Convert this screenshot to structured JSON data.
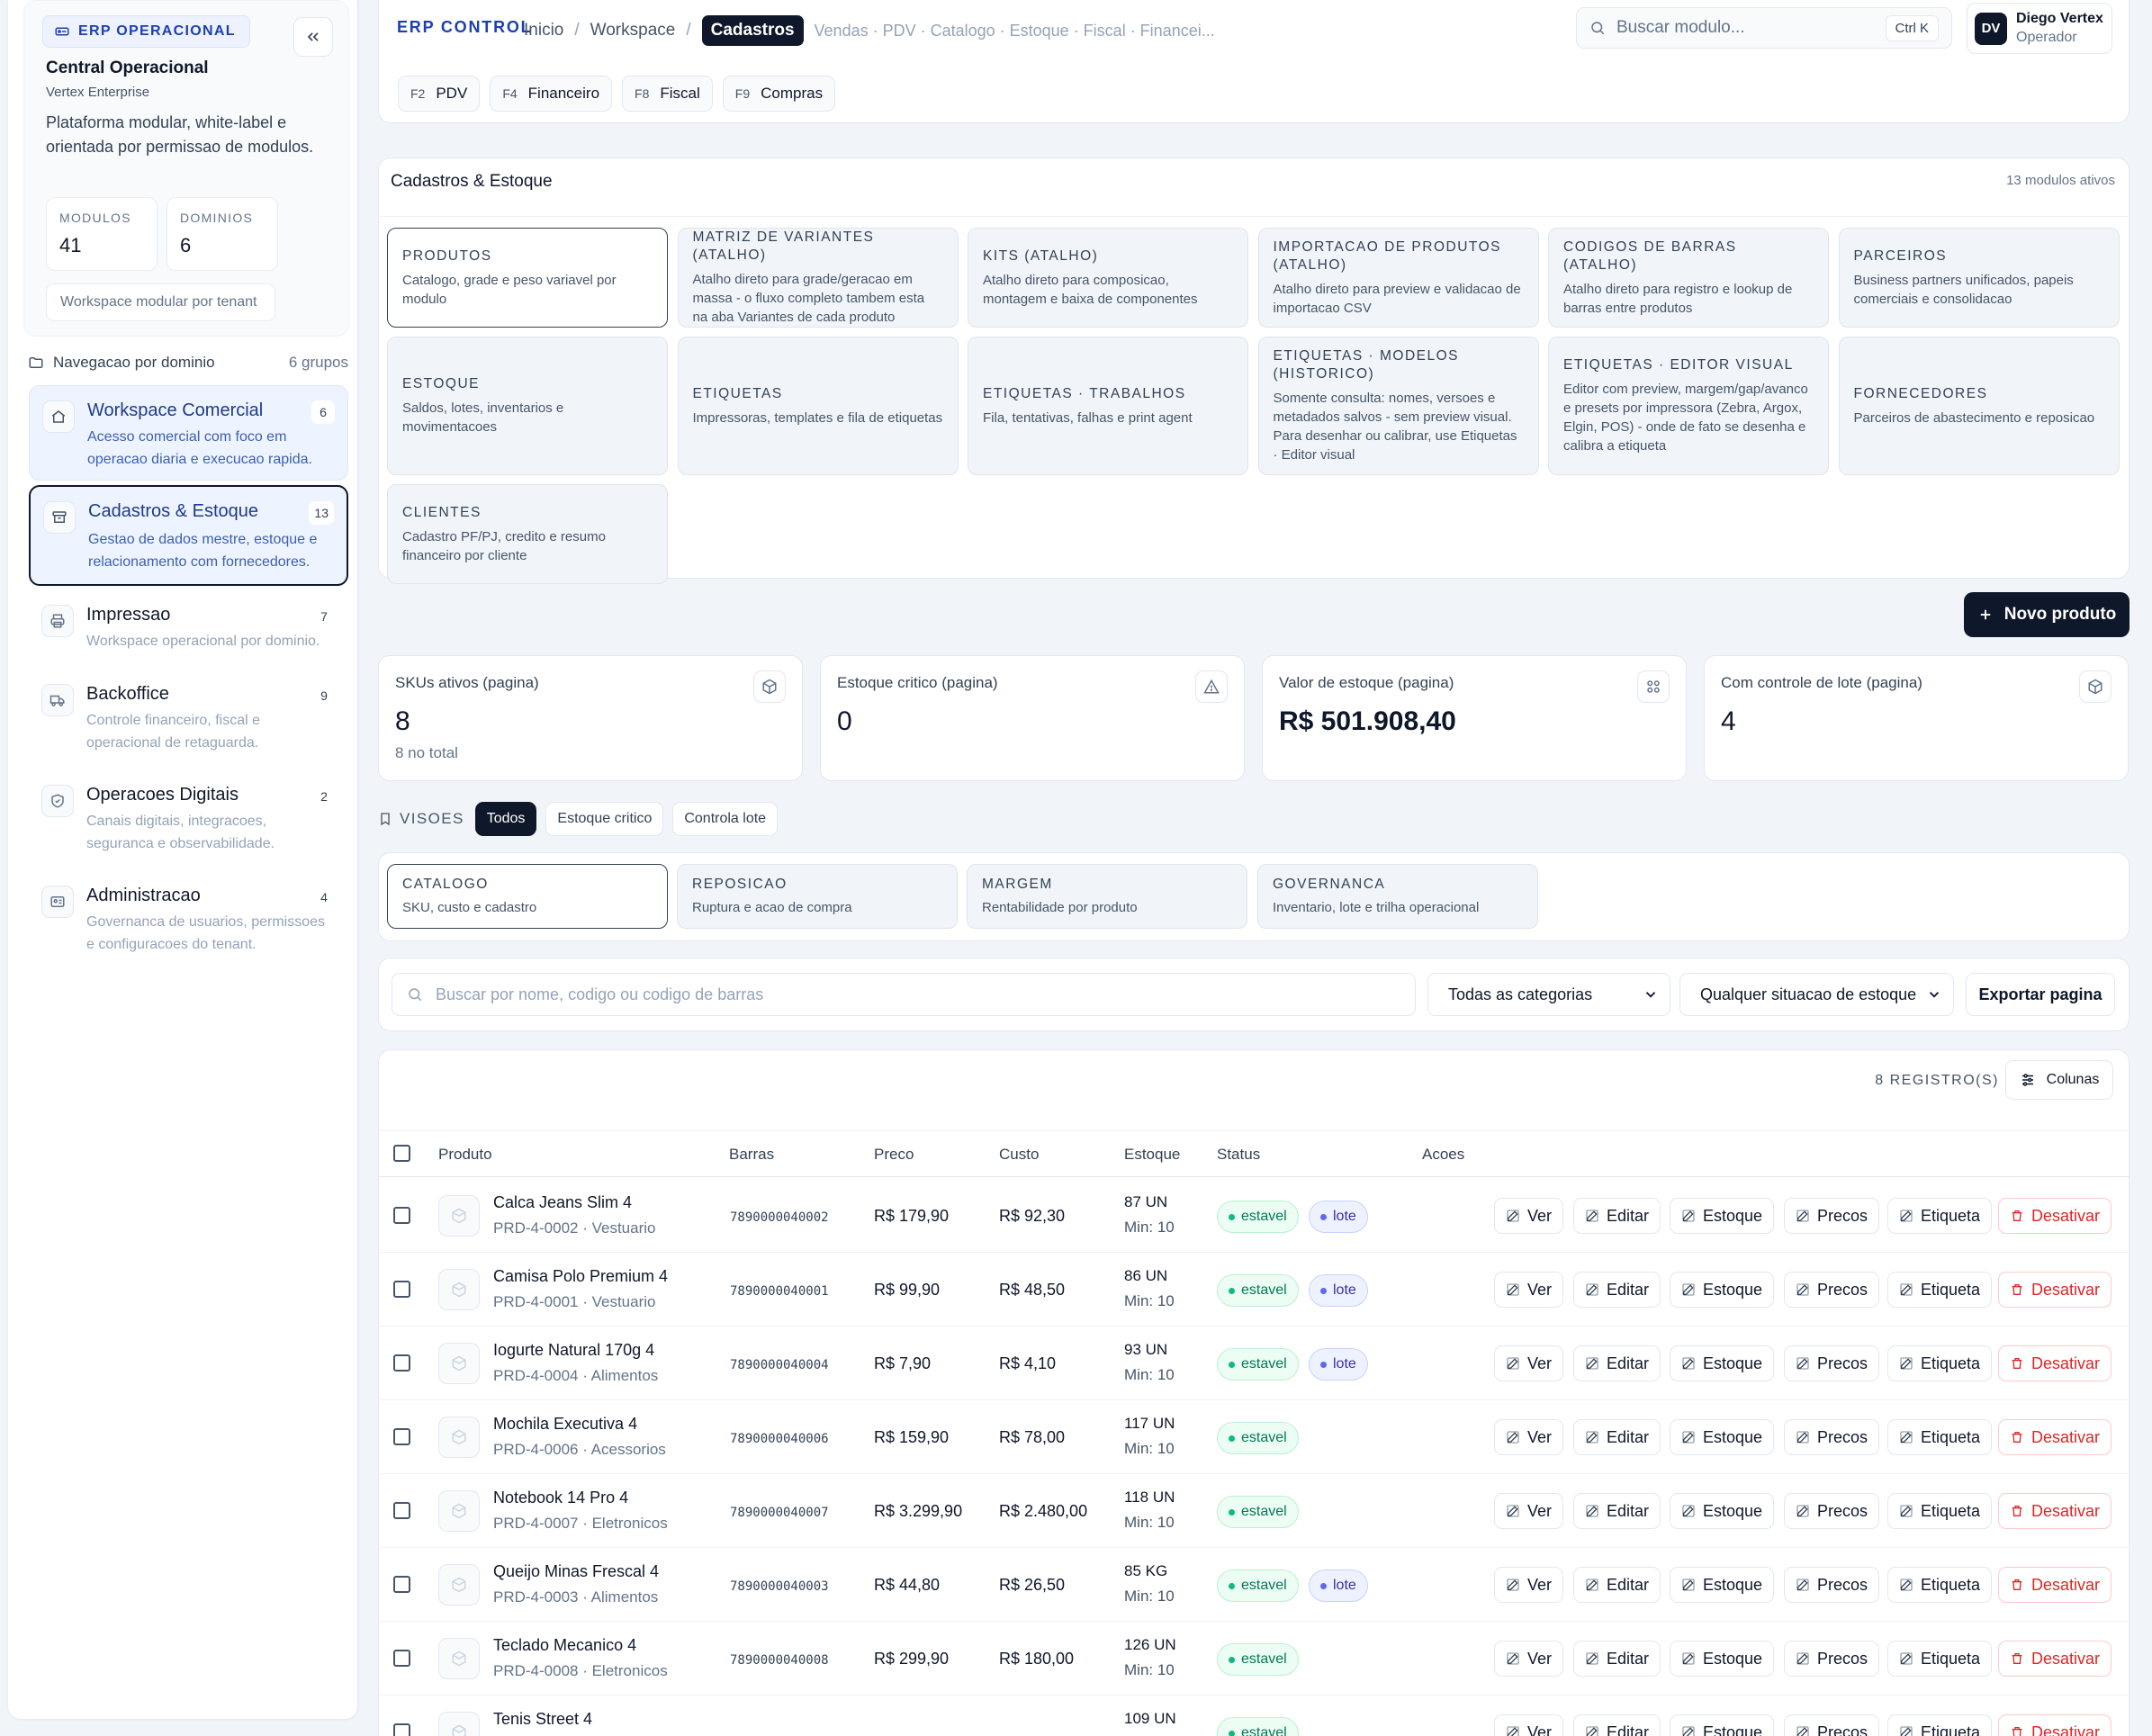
{
  "sidebar": {
    "badge": "ERP OPERACIONAL",
    "org_name": "Central Operacional",
    "org_sub": "Vertex Enterprise",
    "description": "Plataforma modular, white-label e orientada por permissao de modulos.",
    "stats": [
      {
        "label": "MODULOS",
        "value": "41"
      },
      {
        "label": "DOMINIOS",
        "value": "6"
      }
    ],
    "workspace_pill": "Workspace modular por tenant",
    "nav_header": "Navegacao por dominio",
    "nav_count": "6 grupos",
    "items": [
      {
        "title": "Workspace Comercial",
        "count": "6",
        "desc": "Acesso comercial com foco em operacao diaria e execucao rapida.",
        "icon": "home-icon"
      },
      {
        "title": "Cadastros & Estoque",
        "count": "13",
        "desc": "Gestao de dados mestre, estoque e relacionamento com fornecedores.",
        "icon": "archive-icon"
      },
      {
        "title": "Impressao",
        "count": "7",
        "desc": "Workspace operacional por dominio.",
        "icon": "printer-icon"
      },
      {
        "title": "Backoffice",
        "count": "9",
        "desc": "Controle financeiro, fiscal e operacional de retaguarda.",
        "icon": "truck-icon"
      },
      {
        "title": "Operacoes Digitais",
        "count": "2",
        "desc": "Canais digitais, integracoes, seguranca e observabilidade.",
        "icon": "shield-icon"
      },
      {
        "title": "Administracao",
        "count": "4",
        "desc": "Governanca de usuarios, permissoes e configuracoes do tenant.",
        "icon": "id-card-icon"
      }
    ]
  },
  "topbar": {
    "title": "ERP CONTROL",
    "breadcrumbs": [
      "Inicio",
      "Workspace"
    ],
    "current": "Cadastros",
    "more": "Vendas · PDV · Catalogo · Estoque · Fiscal · Financei...",
    "search_placeholder": "Buscar modulo...",
    "search_kbd": "Ctrl K",
    "user_initials": "DV",
    "user_name": "Diego Vertex",
    "user_role": "Operador",
    "shortcuts": [
      {
        "key": "F2",
        "label": "PDV"
      },
      {
        "key": "F4",
        "label": "Financeiro"
      },
      {
        "key": "F8",
        "label": "Fiscal"
      },
      {
        "key": "F9",
        "label": "Compras"
      }
    ]
  },
  "modules": {
    "title": "Cadastros & Estoque",
    "count": "13 modulos ativos",
    "cards": [
      {
        "title": "PRODUTOS",
        "desc": "Catalogo, grade e peso variavel por modulo"
      },
      {
        "title": "MATRIZ DE VARIANTES (ATALHO)",
        "desc": "Atalho direto para grade/geracao em massa - o fluxo completo tambem esta na aba Variantes de cada produto"
      },
      {
        "title": "KITS (ATALHO)",
        "desc": "Atalho direto para composicao, montagem e baixa de componentes"
      },
      {
        "title": "IMPORTACAO DE PRODUTOS (ATALHO)",
        "desc": "Atalho direto para preview e validacao de importacao CSV"
      },
      {
        "title": "CODIGOS DE BARRAS (ATALHO)",
        "desc": "Atalho direto para registro e lookup de barras entre produtos"
      },
      {
        "title": "PARCEIROS",
        "desc": "Business partners unificados, papeis comerciais e consolidacao"
      },
      {
        "title": "ESTOQUE",
        "desc": "Saldos, lotes, inventarios e movimentacoes"
      },
      {
        "title": "ETIQUETAS",
        "desc": "Impressoras, templates e fila de etiquetas"
      },
      {
        "title": "ETIQUETAS · TRABALHOS",
        "desc": "Fila, tentativas, falhas e print agent"
      },
      {
        "title": "ETIQUETAS · MODELOS (HISTORICO)",
        "desc": "Somente consulta: nomes, versoes e metadados salvos - sem preview visual. Para desenhar ou calibrar, use Etiquetas · Editor visual"
      },
      {
        "title": "ETIQUETAS · EDITOR VISUAL",
        "desc": "Editor com preview, margem/gap/avanco e presets por impressora (Zebra, Argox, Elgin, POS) - onde de fato se desenha e calibra a etiqueta"
      },
      {
        "title": "FORNECEDORES",
        "desc": "Parceiros de abastecimento e reposicao"
      },
      {
        "title": "CLIENTES",
        "desc": "Cadastro PF/PJ, credito e resumo financeiro por cliente"
      }
    ]
  },
  "new_product_label": "Novo produto",
  "kpis": [
    {
      "label": "SKUs ativos (pagina)",
      "value": "8",
      "sub": "8 no total",
      "icon": "box-icon"
    },
    {
      "label": "Estoque critico (pagina)",
      "value": "0",
      "sub": "",
      "icon": "alert-triangle-icon"
    },
    {
      "label": "Valor de estoque (pagina)",
      "value": "R$ 501.908,40",
      "sub": "",
      "icon": "grid-icon"
    },
    {
      "label": "Com controle de lote (pagina)",
      "value": "4",
      "sub": "",
      "icon": "box-icon"
    }
  ],
  "views": {
    "label": "VISOES",
    "tabs": [
      "Todos",
      "Estoque critico",
      "Controla lote"
    ],
    "cards": [
      {
        "title": "CATALOGO",
        "desc": "SKU, custo e cadastro"
      },
      {
        "title": "REPOSICAO",
        "desc": "Ruptura e acao de compra"
      },
      {
        "title": "MARGEM",
        "desc": "Rentabilidade por produto"
      },
      {
        "title": "GOVERNANCA",
        "desc": "Inventario, lote e trilha operacional"
      }
    ]
  },
  "filters": {
    "search_placeholder": "Buscar por nome, codigo ou codigo de barras",
    "category": "Todas as categorias",
    "stock_status": "Qualquer situacao de estoque",
    "export": "Exportar pagina"
  },
  "table": {
    "records": "8 REGISTRO(S)",
    "columns_btn": "Colunas",
    "headers": [
      "Produto",
      "Barras",
      "Preco",
      "Custo",
      "Estoque",
      "Status",
      "Acoes"
    ],
    "actions": [
      "Ver",
      "Editar",
      "Estoque",
      "Precos",
      "Etiqueta",
      "Desativar"
    ],
    "rows": [
      {
        "name": "Calca Jeans Slim 4",
        "sub": "PRD-4-0002 · Vestuario",
        "barcode": "7890000040002",
        "price": "R$ 179,90",
        "cost": "R$ 92,30",
        "stock": "87 UN",
        "min": "Min: 10",
        "status": "estavel",
        "lot": "lote"
      },
      {
        "name": "Camisa Polo Premium 4",
        "sub": "PRD-4-0001 · Vestuario",
        "barcode": "7890000040001",
        "price": "R$ 99,90",
        "cost": "R$ 48,50",
        "stock": "86 UN",
        "min": "Min: 10",
        "status": "estavel",
        "lot": "lote"
      },
      {
        "name": "Iogurte Natural 170g 4",
        "sub": "PRD-4-0004 · Alimentos",
        "barcode": "7890000040004",
        "price": "R$ 7,90",
        "cost": "R$ 4,10",
        "stock": "93 UN",
        "min": "Min: 10",
        "status": "estavel",
        "lot": "lote"
      },
      {
        "name": "Mochila Executiva 4",
        "sub": "PRD-4-0006 · Acessorios",
        "barcode": "7890000040006",
        "price": "R$ 159,90",
        "cost": "R$ 78,00",
        "stock": "117 UN",
        "min": "Min: 10",
        "status": "estavel",
        "lot": ""
      },
      {
        "name": "Notebook 14 Pro 4",
        "sub": "PRD-4-0007 · Eletronicos",
        "barcode": "7890000040007",
        "price": "R$ 3.299,90",
        "cost": "R$ 2.480,00",
        "stock": "118 UN",
        "min": "Min: 10",
        "status": "estavel",
        "lot": ""
      },
      {
        "name": "Queijo Minas Frescal 4",
        "sub": "PRD-4-0003 · Alimentos",
        "barcode": "7890000040003",
        "price": "R$ 44,80",
        "cost": "R$ 26,50",
        "stock": "85 KG",
        "min": "Min: 10",
        "status": "estavel",
        "lot": "lote"
      },
      {
        "name": "Teclado Mecanico 4",
        "sub": "PRD-4-0008 · Eletronicos",
        "barcode": "7890000040008",
        "price": "R$ 299,90",
        "cost": "R$ 180,00",
        "stock": "126 UN",
        "min": "Min: 10",
        "status": "estavel",
        "lot": ""
      },
      {
        "name": "Tenis Street 4",
        "sub": "",
        "barcode": "",
        "price": "",
        "cost": "",
        "stock": "109 UN",
        "min": "",
        "status": "estavel",
        "lot": ""
      }
    ]
  }
}
